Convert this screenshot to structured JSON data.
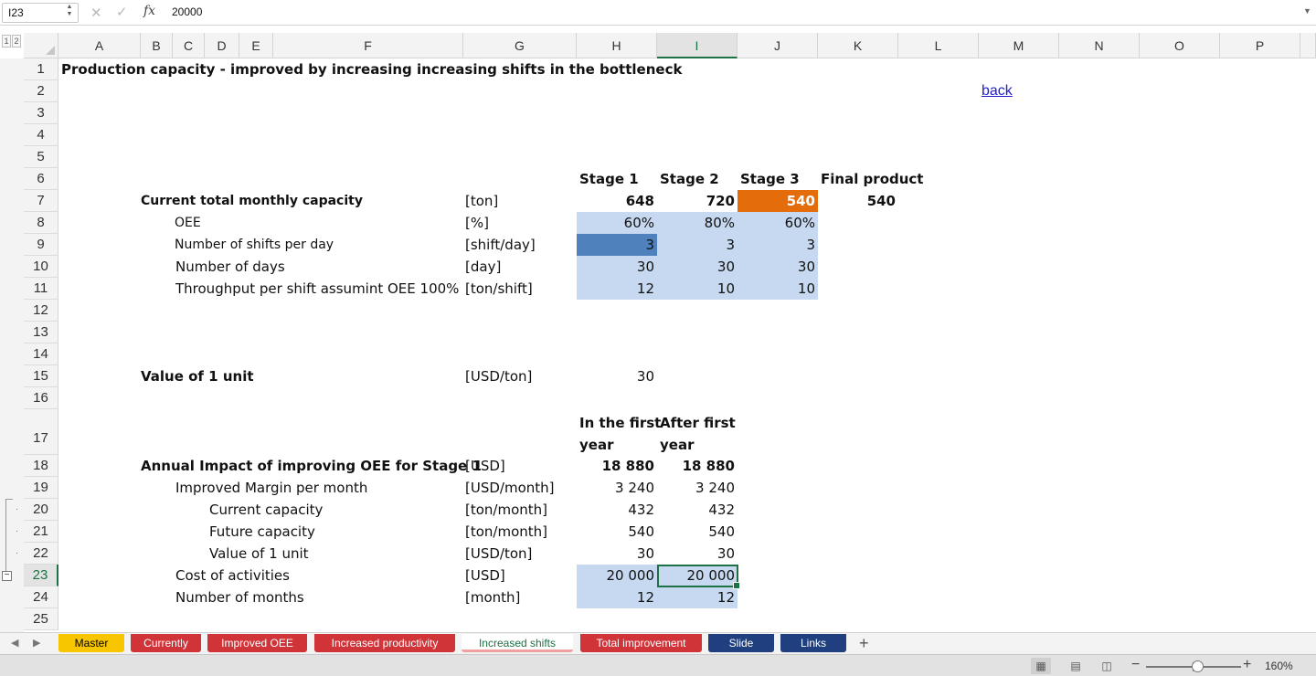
{
  "formula_bar": {
    "cell_ref": "I23",
    "formula": "20000"
  },
  "outline_levels": [
    "1",
    "2"
  ],
  "columns": [
    "A",
    "B",
    "C",
    "D",
    "E",
    "F",
    "G",
    "H",
    "I",
    "J",
    "K",
    "L",
    "M",
    "N",
    "O",
    "P"
  ],
  "rows": [
    "1",
    "2",
    "3",
    "4",
    "5",
    "6",
    "7",
    "8",
    "9",
    "10",
    "11",
    "12",
    "13",
    "14",
    "15",
    "16",
    "17",
    "18",
    "19",
    "20",
    "21",
    "22",
    "23",
    "24",
    "25"
  ],
  "sheet": {
    "title": "Production capacity - improved by increasing increasing shifts in the bottleneck",
    "link_back": "back",
    "stage_headers": [
      "Stage 1",
      "Stage 2",
      "Stage 3",
      "Final product"
    ],
    "capacity": {
      "label": "Current total monthly capacity",
      "unit": "[ton]",
      "values": [
        "648",
        "720",
        "540"
      ],
      "final": "540"
    },
    "oee": {
      "label": "OEE",
      "unit": "[%]",
      "values": [
        "60%",
        "80%",
        "60%"
      ]
    },
    "shifts": {
      "label": "Number of shifts per day",
      "unit": "[shift/day]",
      "values": [
        "3",
        "3",
        "3"
      ]
    },
    "days": {
      "label": "Number of days",
      "unit": "[day]",
      "values": [
        "30",
        "30",
        "30"
      ]
    },
    "throughput": {
      "label": "Throughput per shift assumint OEE 100%",
      "unit": "[ton/shift]",
      "values": [
        "12",
        "10",
        "10"
      ]
    },
    "value_unit": {
      "label": "Value of 1 unit",
      "unit": "[USD/ton]",
      "value": "30"
    },
    "period_headers": {
      "first_line": [
        "In the first",
        "After first"
      ],
      "second_line": [
        "year",
        "year"
      ]
    },
    "impact_rows": [
      {
        "label": "Annual Impact of improving OEE for Stage 1",
        "unit": "[USD]",
        "values": [
          "18 880",
          "18 880"
        ]
      },
      {
        "label": "Improved Margin per month",
        "unit": "[USD/month]",
        "values": [
          "3 240",
          "3 240"
        ]
      },
      {
        "label": "Current capacity",
        "unit": "[ton/month]",
        "values": [
          "432",
          "432"
        ]
      },
      {
        "label": "Future capacity",
        "unit": "[ton/month]",
        "values": [
          "540",
          "540"
        ]
      },
      {
        "label": "Value of 1 unit",
        "unit": "[USD/ton]",
        "values": [
          "30",
          "30"
        ]
      },
      {
        "label": "Cost of activities",
        "unit": "[USD]",
        "values": [
          "20 000",
          "20 000"
        ]
      },
      {
        "label": "Number of months",
        "unit": "[month]",
        "values": [
          "12",
          "12"
        ]
      }
    ]
  },
  "tabs": [
    {
      "label": "Master",
      "color": "#f7c600",
      "text_color": "#000000"
    },
    {
      "label": "Currently",
      "color": "#d13438",
      "text_color": "#ffffff"
    },
    {
      "label": "Improved OEE",
      "color": "#d13438",
      "text_color": "#ffffff"
    },
    {
      "label": "Increased productivity",
      "color": "#d13438",
      "text_color": "#ffffff"
    },
    {
      "label": "Increased shifts",
      "color": "#f4c7c7",
      "text_color": "#1e7145",
      "active": true
    },
    {
      "label": "Total improvement",
      "color": "#d13438",
      "text_color": "#ffffff"
    },
    {
      "label": "Slide",
      "color": "#1f3f7f",
      "text_color": "#ffffff"
    },
    {
      "label": "Links",
      "color": "#1f3f7f",
      "text_color": "#ffffff"
    }
  ],
  "add_sheet": "+",
  "status": {
    "zoom": "160%"
  },
  "colors": {
    "input_fill": "#c6d9f1",
    "selected_shift_fill": "#4f81bd",
    "bottleneck_fill": "#e46c0a",
    "accent": "#1e7145"
  },
  "icons": [
    "cancel-icon",
    "enter-icon",
    "fx-icon",
    "normal-view-icon",
    "page-layout-icon",
    "page-break-icon"
  ]
}
